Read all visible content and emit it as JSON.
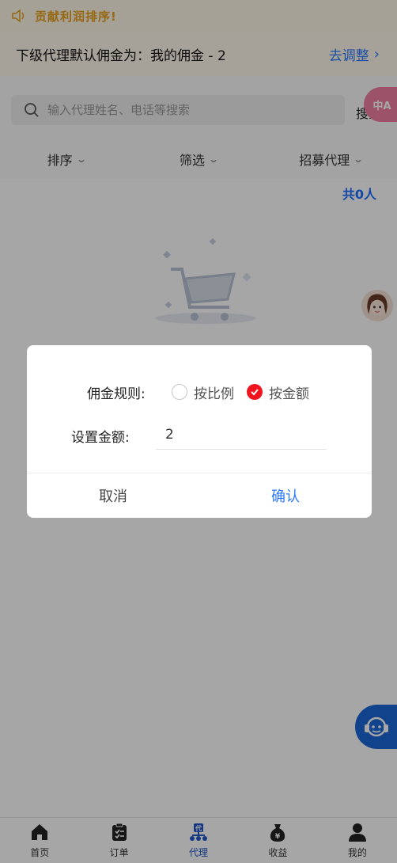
{
  "notice": {
    "text": "贡献利润排序!",
    "icon": "speaker-icon"
  },
  "commission": {
    "text": "下级代理默认佣金为：我的佣金 - 2",
    "adjust_label": "去调整"
  },
  "search": {
    "placeholder": "输入代理姓名、电话等搜索",
    "button": "搜索"
  },
  "lang_badge": "中A",
  "filters": [
    {
      "label": "排序"
    },
    {
      "label": "筛选"
    },
    {
      "label": "招募代理"
    }
  ],
  "total": "共0人",
  "dialog": {
    "rule_label": "佣金规则:",
    "options": [
      {
        "label": "按比例",
        "checked": false
      },
      {
        "label": "按金额",
        "checked": true
      }
    ],
    "amount_label": "设置金额:",
    "amount_value": "2",
    "cancel": "取消",
    "confirm": "确认"
  },
  "tabbar": [
    {
      "label": "首页",
      "icon": "home-icon"
    },
    {
      "label": "订单",
      "icon": "orders-icon"
    },
    {
      "label": "代理",
      "icon": "agent-icon",
      "active": true
    },
    {
      "label": "收益",
      "icon": "earnings-icon"
    },
    {
      "label": "我的",
      "icon": "profile-icon"
    }
  ],
  "colors": {
    "accent": "#2b78ff",
    "radio_checked": "#f2141c",
    "active_tab": "#1f56c8",
    "notice": "#e8a020"
  }
}
